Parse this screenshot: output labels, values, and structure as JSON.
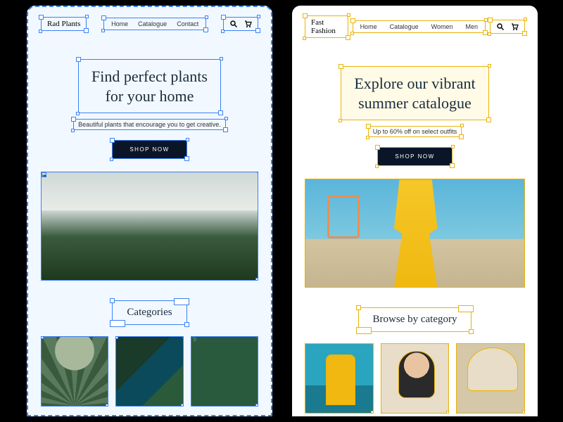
{
  "left": {
    "logo": "Rad Plants",
    "nav": [
      "Home",
      "Catalogue",
      "Contact"
    ],
    "hero_title_l1": "Find perfect plants",
    "hero_title_l2": "for your home",
    "sub": "Beautiful plants that encourage you to get creative.",
    "cta": "SHOP NOW",
    "cat_title": "Categories",
    "accent": "#3b82f6"
  },
  "right": {
    "logo": "Fast Fashion",
    "nav": [
      "Home",
      "Catalogue",
      "Women",
      "Men"
    ],
    "hero_title_l1": "Explore our vibrant",
    "hero_title_l2": "summer catalogue",
    "sub": "Up to 60% off on select outfits",
    "cta": "SHOP NOW",
    "cat_title": "Browse by category",
    "accent": "#eab308"
  },
  "icons": {
    "search": "search-icon",
    "cart": "cart-icon"
  }
}
